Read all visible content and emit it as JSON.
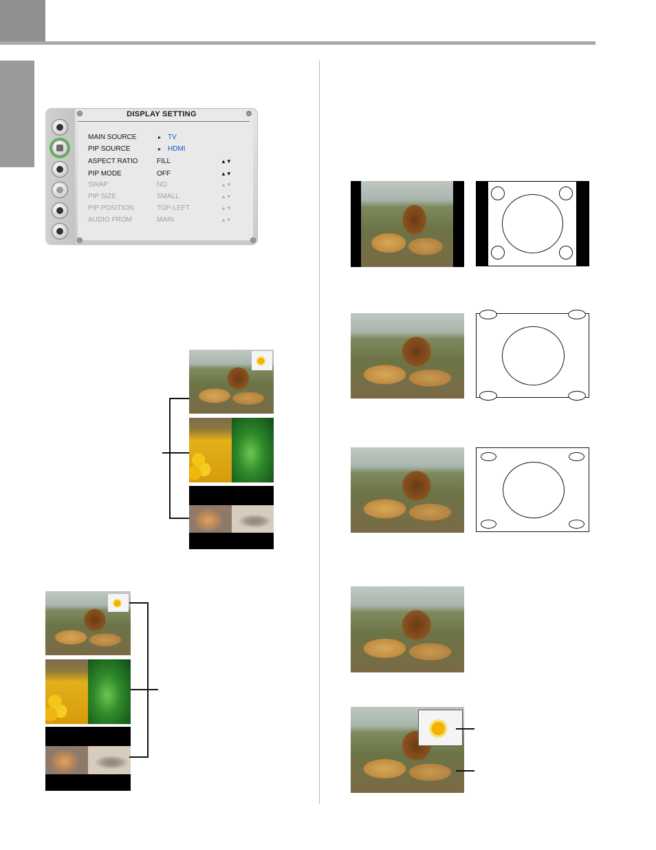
{
  "osd": {
    "title": "DISPLAY SETTING",
    "rows": [
      {
        "label": "MAIN SOURCE",
        "value": "TV",
        "control": "▸"
      },
      {
        "label": "PIP SOURCE",
        "value": "HDMI",
        "control": "▸"
      },
      {
        "label": "ASPECT RATIO",
        "value": "FILL",
        "control": "▲▼"
      },
      {
        "label": "PIP MODE",
        "value": "OFF",
        "control": "▲▼"
      },
      {
        "label": "SWAP",
        "value": "NO",
        "control": "▲▼"
      },
      {
        "label": "PIP SIZE",
        "value": "SMALL",
        "control": "▲▼"
      },
      {
        "label": "PIP POSITION",
        "value": "TOP-LEFT",
        "control": "▲▼"
      },
      {
        "label": "AUDIO FROM",
        "value": "MAIN",
        "control": "▲▼"
      }
    ],
    "icons": [
      "setup-icon",
      "display-icon",
      "camera-icon",
      "tv-icon",
      "lock-icon",
      "headphone-icon"
    ],
    "accent_selected": "#57b857",
    "link_color": "#1d4fd6"
  }
}
